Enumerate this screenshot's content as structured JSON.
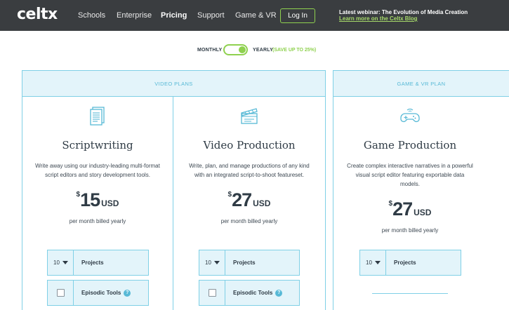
{
  "nav": {
    "logo": "celtx",
    "links": [
      "Schools",
      "Enterprise",
      "Pricing",
      "Support",
      "Game & VR"
    ],
    "login": "Log In",
    "webinar_title": "Latest webinar: The Evolution of Media Creation",
    "webinar_link": "Learn more on the Celtx Blog"
  },
  "billing": {
    "monthly": "MONTHLY",
    "yearly": "YEARLY",
    "save": "(SAVE UP TO 25%)",
    "selected": "yearly"
  },
  "sections": {
    "video_plans": "VIDEO PLANS",
    "game_plan": "GAME & VR PLAN"
  },
  "plans": [
    {
      "name": "Scriptwriting",
      "description": "Write away using our industry-leading multi-format script editors and story development tools.",
      "currency": "$",
      "amount": "15",
      "unit": "USD",
      "billed": "per month billed yearly",
      "projects_count": "10",
      "projects_label": "Projects",
      "episodic_label": "Episodic Tools",
      "icon": "script-document-icon"
    },
    {
      "name": "Video Production",
      "description": "Write, plan, and manage productions of any kind with an integrated script-to-shoot featureset.",
      "currency": "$",
      "amount": "27",
      "unit": "USD",
      "billed": "per month billed yearly",
      "projects_count": "10",
      "projects_label": "Projects",
      "episodic_label": "Episodic Tools",
      "icon": "clapperboard-icon"
    },
    {
      "name": "Game Production",
      "description": "Create complex interactive narratives in a powerful visual script editor featuring exportable data models.",
      "currency": "$",
      "amount": "27",
      "unit": "USD",
      "billed": "per month billed yearly",
      "projects_count": "10",
      "projects_label": "Projects",
      "icon": "gamepad-icon"
    }
  ],
  "colors": {
    "nav_bg": "#3a3d40",
    "accent_green": "#8fd14f",
    "accent_blue": "#7fd0e6",
    "panel_bg": "#e3f4fa"
  }
}
